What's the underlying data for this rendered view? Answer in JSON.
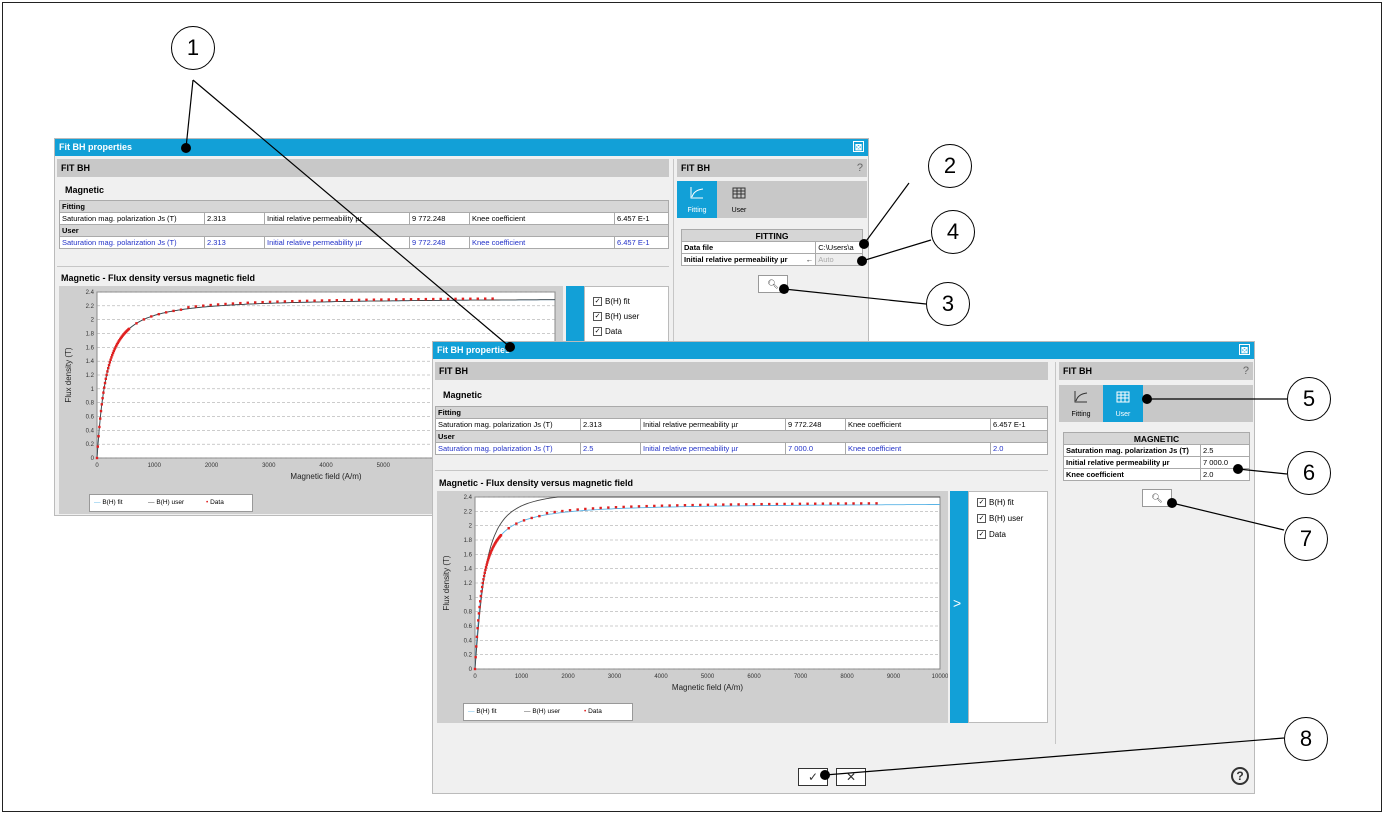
{
  "window_back": {
    "title": "Fit BH properties",
    "close_label": "⊠",
    "header": "FIT BH",
    "section_title": "Magnetic",
    "table": {
      "fitting_label": "Fitting",
      "fitting_row": [
        "Saturation mag. polarization Js (T)",
        "2.313",
        "Initial relative permeability µr",
        "9 772.248",
        "Knee coefficient",
        "6.457 E-1"
      ],
      "user_label": "User",
      "user_row": [
        "Saturation mag. polarization Js (T)",
        "2.313",
        "Initial relative permeability µr",
        "9 772.248",
        "Knee coefficient",
        "6.457 E-1"
      ]
    },
    "plot_title": "Magnetic - Flux density versus magnetic field",
    "legend": [
      "B(H) fit",
      "B(H) user",
      "Data"
    ],
    "checkboxes": [
      "B(H) fit",
      "B(H) user",
      "Data"
    ],
    "right_panel": {
      "header": "FIT BH",
      "help": "?",
      "tabs": [
        "Fitting",
        "User"
      ],
      "active_tab": "Fitting",
      "table_title": "FITTING",
      "rows": [
        [
          "Data file",
          "C:\\Users\\a"
        ],
        [
          "Initial relative permeability µr",
          "Auto"
        ]
      ],
      "arrow": "←"
    }
  },
  "window_front": {
    "title": "Fit BH properties",
    "close_label": "⊠",
    "header": "FIT BH",
    "section_title": "Magnetic",
    "table": {
      "fitting_label": "Fitting",
      "fitting_row": [
        "Saturation mag. polarization Js (T)",
        "2.313",
        "Initial relative permeability µr",
        "9 772.248",
        "Knee coefficient",
        "6.457 E-1"
      ],
      "user_label": "User",
      "user_row": [
        "Saturation mag. polarization Js (T)",
        "2.5",
        "Initial relative permeability µr",
        "7 000.0",
        "Knee coefficient",
        "2.0"
      ]
    },
    "plot_title": "Magnetic - Flux density versus magnetic field",
    "legend": [
      "B(H) fit",
      "B(H) user",
      "Data"
    ],
    "checkboxes": [
      "B(H) fit",
      "B(H) user",
      "Data"
    ],
    "expand_label": ">",
    "right_panel": {
      "header": "FIT BH",
      "help": "?",
      "tabs": [
        "Fitting",
        "User"
      ],
      "active_tab": "User",
      "table_title": "MAGNETIC",
      "rows": [
        [
          "Saturation mag. polarization Js (T)",
          "2.5"
        ],
        [
          "Initial relative permeability µr",
          "7 000.0"
        ],
        [
          "Knee coefficient",
          "2.0"
        ]
      ]
    },
    "ok_label": "✓",
    "cancel_label": "✕",
    "help_label": "?"
  },
  "chart_data": [
    {
      "type": "line",
      "title": "Magnetic - Flux density versus magnetic field",
      "xlabel": "Magnetic field (A/m)",
      "ylabel": "Flux density (T)",
      "x_ticks": [
        0,
        1000,
        2000,
        3000,
        4000,
        5000,
        6000,
        7000
      ],
      "y_ticks": [
        0,
        0.2,
        0.4,
        0.6,
        0.8,
        1,
        1.2,
        1.4,
        1.6,
        1.8,
        2,
        2.2,
        2.4
      ],
      "y_tick_labels": [
        "0",
        "0.2",
        "0.4",
        "0.6",
        "0.8",
        "1",
        "1.2",
        "1.4",
        "1.6",
        "1.8",
        "2",
        "2.2",
        "2.4"
      ],
      "xlim": [
        0,
        8000
      ],
      "ylim": [
        0,
        2.4
      ],
      "series": [
        {
          "name": "B(H) fit",
          "color": "#5ab4e6",
          "Js": 2.313,
          "mur": 9772.248,
          "knee": 0.6457
        },
        {
          "name": "B(H) user",
          "color": "#444444",
          "Js": 2.313,
          "mur": 9772.248,
          "knee": 0.6457
        },
        {
          "name": "Data",
          "color": "#e02020",
          "style": "points"
        }
      ],
      "grid": true
    },
    {
      "type": "line",
      "title": "Magnetic - Flux density versus magnetic field",
      "xlabel": "Magnetic field (A/m)",
      "ylabel": "Flux density (T)",
      "x_ticks": [
        0,
        1000,
        2000,
        3000,
        4000,
        5000,
        6000,
        7000,
        8000,
        9000,
        10000
      ],
      "y_ticks": [
        0,
        0.2,
        0.4,
        0.6,
        0.8,
        1,
        1.2,
        1.4,
        1.6,
        1.8,
        2,
        2.2,
        2.4
      ],
      "y_tick_labels": [
        "0",
        "0.2",
        "0.4",
        "0.6",
        "0.8",
        "1",
        "1.2",
        "1.4",
        "1.6",
        "1.8",
        "2",
        "2.2",
        "2.4"
      ],
      "xlim": [
        0,
        10000
      ],
      "ylim": [
        0,
        2.4
      ],
      "series": [
        {
          "name": "B(H) fit",
          "color": "#5ab4e6",
          "Js": 2.313,
          "mur": 9772.248,
          "knee": 0.6457
        },
        {
          "name": "B(H) user",
          "color": "#444444",
          "Js": 2.5,
          "mur": 7000.0,
          "knee": 2.0
        },
        {
          "name": "Data",
          "color": "#e02020",
          "style": "points"
        }
      ],
      "grid": true
    }
  ],
  "callouts": [
    "1",
    "2",
    "3",
    "4",
    "5",
    "6",
    "7",
    "8"
  ]
}
